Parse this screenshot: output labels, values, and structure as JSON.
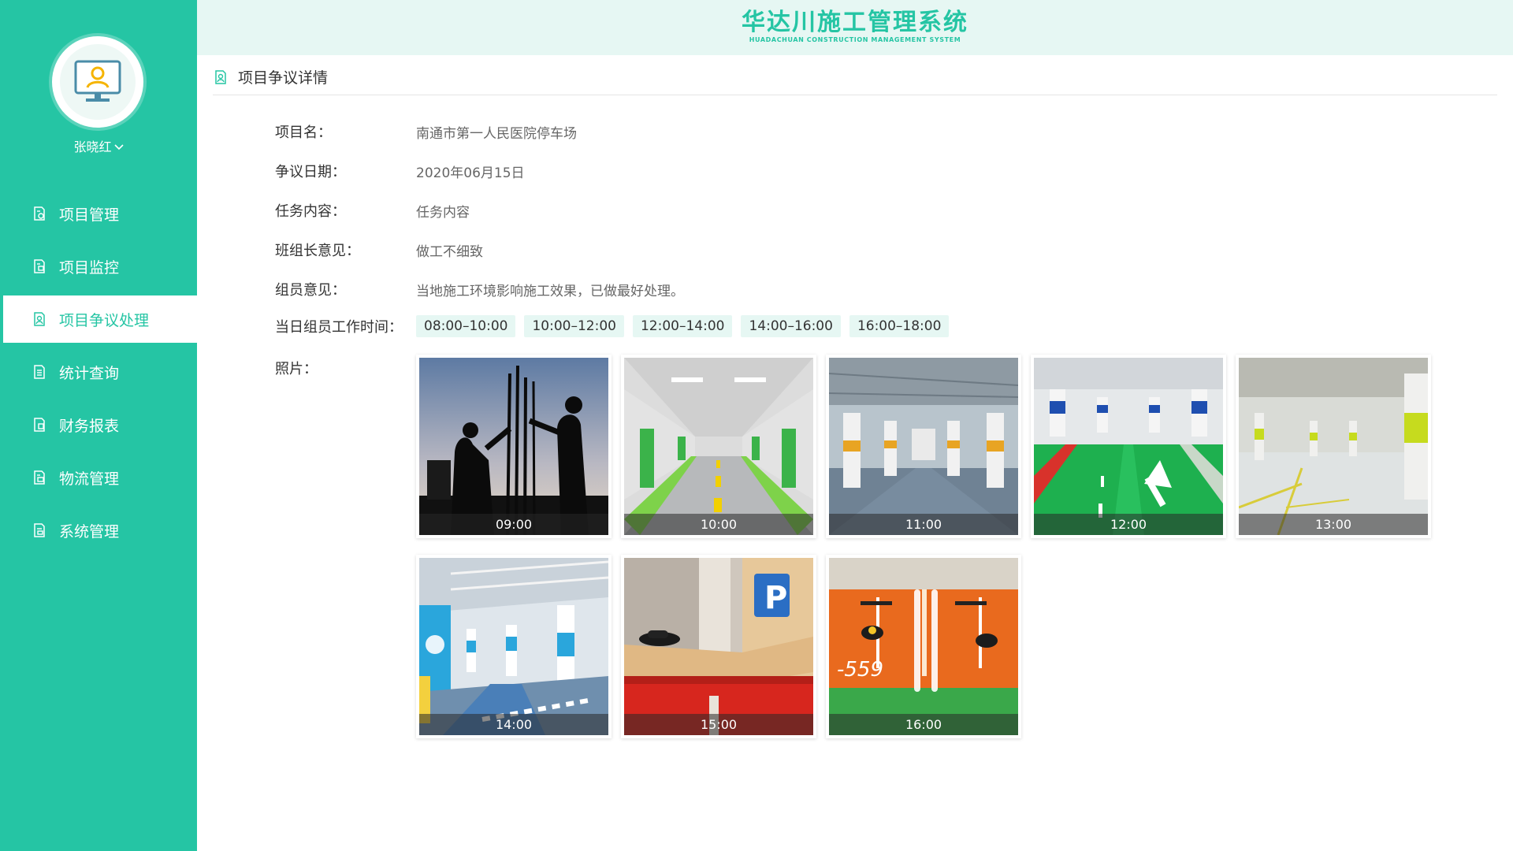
{
  "app": {
    "title": "华达川施工管理系统",
    "subtitle": "HUADACHUAN CONSTRUCTION MANAGEMENT SYSTEM"
  },
  "user": {
    "name": "张晓红"
  },
  "sidebar": {
    "items": [
      {
        "label": "项目管理",
        "icon": "project-icon",
        "active": false
      },
      {
        "label": "项目监控",
        "icon": "monitor-icon",
        "active": false
      },
      {
        "label": "项目争议处理",
        "icon": "dispute-icon",
        "active": true
      },
      {
        "label": "统计查询",
        "icon": "statistics-icon",
        "active": false
      },
      {
        "label": "财务报表",
        "icon": "finance-icon",
        "active": false
      },
      {
        "label": "物流管理",
        "icon": "logistics-icon",
        "active": false
      },
      {
        "label": "系统管理",
        "icon": "settings-icon",
        "active": false
      }
    ]
  },
  "page": {
    "title": "项目争议详情",
    "fields": {
      "project_name": {
        "label": "项目名：",
        "value": "南通市第一人民医院停车场"
      },
      "dispute_date": {
        "label": "争议日期：",
        "value": "2020年06月15日"
      },
      "task_content": {
        "label": "任务内容：",
        "value": "任务内容"
      },
      "leader_opinion": {
        "label": "班组长意见：",
        "value": "做工不细致"
      },
      "member_opinion": {
        "label": "组员意见：",
        "value": "当地施工环境影响施工效果，已做最好处理。"
      },
      "work_time": {
        "label": "当日组员工作时间："
      },
      "photos": {
        "label": "照片："
      }
    },
    "time_slots": [
      "08:00–10:00",
      "10:00–12:00",
      "12:00–14:00",
      "14:00–16:00",
      "16:00–18:00"
    ],
    "photos": [
      {
        "time": "09:00",
        "scene": "workers-silhouette"
      },
      {
        "time": "10:00",
        "scene": "parking-lane-green"
      },
      {
        "time": "11:00",
        "scene": "parking-garage-columns"
      },
      {
        "time": "12:00",
        "scene": "green-floor-arrows"
      },
      {
        "time": "13:00",
        "scene": "white-garage-yellow"
      },
      {
        "time": "14:00",
        "scene": "blue-garage-render"
      },
      {
        "time": "15:00",
        "scene": "parking-model-toy"
      },
      {
        "time": "16:00",
        "scene": "orange-parking-floor"
      }
    ]
  },
  "colors": {
    "accent": "#25c5a4",
    "header_bg": "#e6f7f3",
    "slot_bg": "#e6f7f3"
  }
}
